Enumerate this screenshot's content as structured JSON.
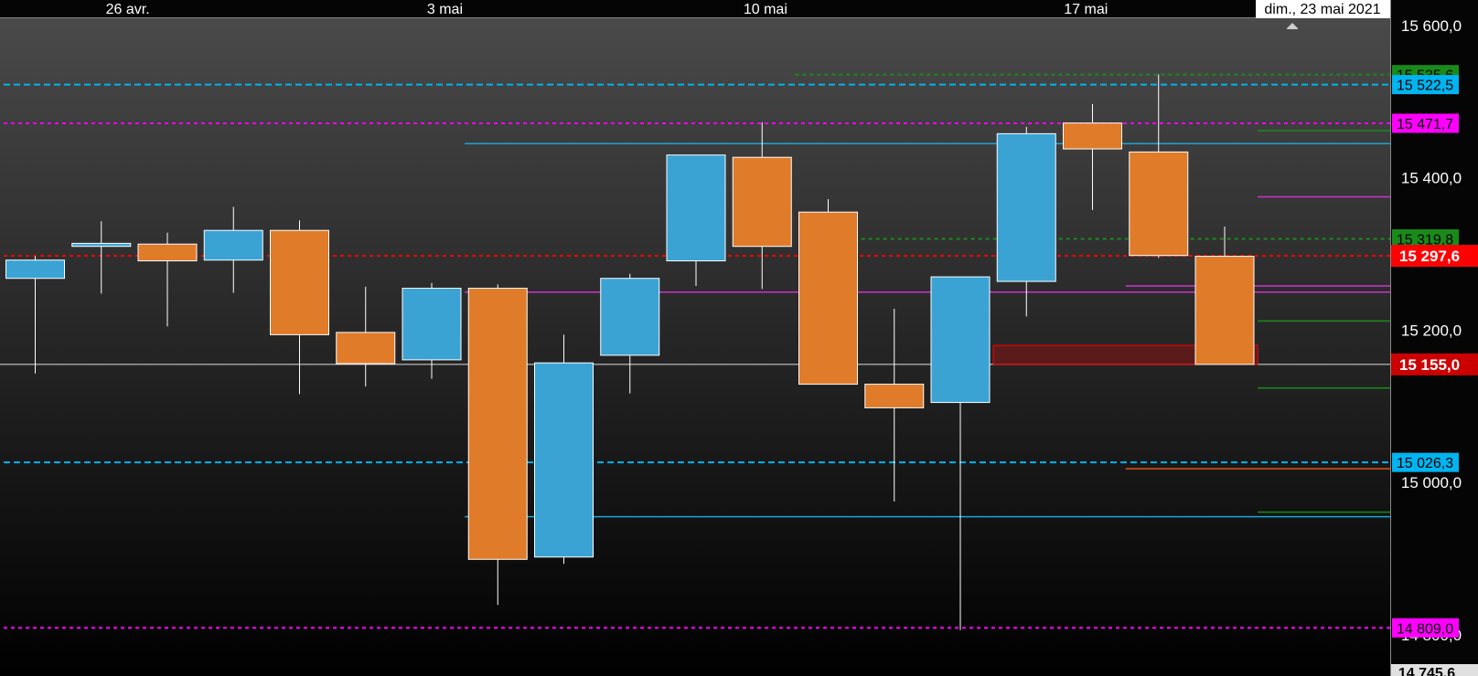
{
  "chart_data": {
    "type": "candlestick",
    "x_labels": [
      "26 avr.",
      "3 mai",
      "10 mai",
      "17 mai"
    ],
    "cursor_date": "dim., 23 mai 2021",
    "y_range": [
      14745.6,
      15600.0
    ],
    "y_ticks": [
      {
        "value": 15600,
        "label": "15 600,0"
      },
      {
        "value": 15400,
        "label": "15 400,0"
      },
      {
        "value": 15200,
        "label": "15 200,0"
      },
      {
        "value": 15000,
        "label": "15 000,0"
      },
      {
        "value": 14800,
        "label": "14 800,0"
      }
    ],
    "bottom_value_label": "14 745,6",
    "candles": [
      {
        "open": 15268,
        "high": 15297,
        "low": 15143,
        "close": 15292
      },
      {
        "open": 15310,
        "high": 15343,
        "low": 15248,
        "close": 15314
      },
      {
        "open": 15313,
        "high": 15328,
        "low": 15205,
        "close": 15291
      },
      {
        "open": 15292,
        "high": 15362,
        "low": 15249,
        "close": 15331
      },
      {
        "open": 15331,
        "high": 15344,
        "low": 15116,
        "close": 15194
      },
      {
        "open": 15197,
        "high": 15257,
        "low": 15126,
        "close": 15156
      },
      {
        "open": 15161,
        "high": 15262,
        "low": 15136,
        "close": 15255
      },
      {
        "open": 15255,
        "high": 15260,
        "low": 14839,
        "close": 14899
      },
      {
        "open": 14902,
        "high": 15194,
        "low": 14893,
        "close": 15157
      },
      {
        "open": 15167,
        "high": 15274,
        "low": 15117,
        "close": 15268
      },
      {
        "open": 15291,
        "high": 15429,
        "low": 15258,
        "close": 15430
      },
      {
        "open": 15427,
        "high": 15473,
        "low": 15254,
        "close": 15310
      },
      {
        "open": 15355,
        "high": 15372,
        "low": 15131,
        "close": 15129
      },
      {
        "open": 15129,
        "high": 15228,
        "low": 14975,
        "close": 15098
      },
      {
        "open": 15105,
        "high": 15262,
        "low": 14806,
        "close": 15270
      },
      {
        "open": 15264,
        "high": 15467,
        "low": 15218,
        "close": 15458
      },
      {
        "open": 15472,
        "high": 15497,
        "low": 15358,
        "close": 15438
      },
      {
        "open": 15434,
        "high": 15536,
        "low": 15295,
        "close": 15298
      },
      {
        "open": 15297,
        "high": 15336,
        "low": 15166,
        "close": 15155
      }
    ],
    "price_levels": [
      {
        "value": 15535.6,
        "label": "15 535,6",
        "color": "#1a8a1a",
        "style": "dotted",
        "from_candle": 11.5
      },
      {
        "value": 15522.5,
        "label": "15 522,5",
        "color": "#00b4f0",
        "style": "dashed",
        "from_candle": 0
      },
      {
        "value": 15471.7,
        "label": "15 471,7",
        "color": "#ff00ff",
        "style": "dotted",
        "from_candle": 0
      },
      {
        "value": 15319.8,
        "label": "15 319,8",
        "color": "#1a8a1a",
        "style": "dotted",
        "from_candle": 12.5
      },
      {
        "value": 15297.6,
        "label": "15 297,6",
        "color": "#ff0000",
        "style": "dotted",
        "from_candle": 0
      },
      {
        "value": 15155.0,
        "label": "15 155,0",
        "color": "#ff0000",
        "style": "solid",
        "from_candle": 0
      },
      {
        "value": 15026.3,
        "label": "15 026,3",
        "color": "#00b4f0",
        "style": "dashed",
        "from_candle": 0
      },
      {
        "value": 14809.0,
        "label": "14 809,0",
        "color": "#ff00ff",
        "style": "dotted",
        "from_candle": 0
      }
    ],
    "trend_lines": [
      {
        "value": 15445,
        "color": "#1aa6d9",
        "from_candle": 6.5
      },
      {
        "value": 15250,
        "color": "#cc33cc",
        "from_candle": 6.5
      },
      {
        "value": 14955,
        "color": "#1aa6d9",
        "from_candle": 6.5
      },
      {
        "value": 15258,
        "color": "#cc33cc",
        "from_candle": 16.5
      },
      {
        "value": 15018,
        "color": "#e0551a",
        "from_candle": 16.5
      },
      {
        "value": 15462,
        "color": "#1a8a1a",
        "from_candle": 18.5
      },
      {
        "value": 15375,
        "color": "#cc33cc",
        "from_candle": 18.5
      },
      {
        "value": 15212,
        "color": "#1a8a1a",
        "from_candle": 18.5
      },
      {
        "value": 15124,
        "color": "#1a8a1a",
        "from_candle": 18.5
      },
      {
        "value": 14961,
        "color": "#1a8a1a",
        "from_candle": 18.5
      }
    ],
    "zone": {
      "top": 15180,
      "bottom": 15155,
      "from_candle": 14.5,
      "to_candle": 18.5,
      "color": "#ff0000"
    },
    "colors": {
      "up": "#3aa3d4",
      "down": "#e07b29",
      "wick": "#ffffff",
      "axis_text": "#ffffff",
      "label_text": "#000000"
    }
  }
}
